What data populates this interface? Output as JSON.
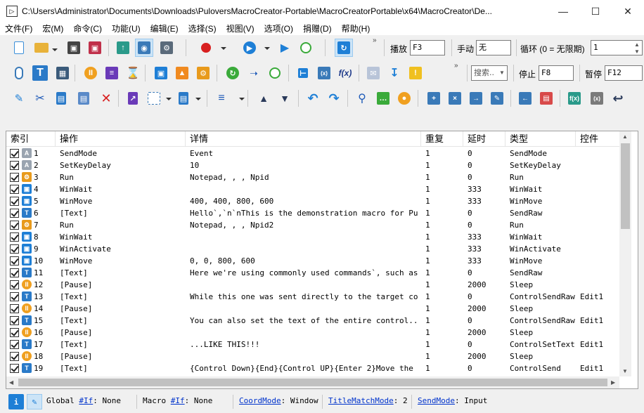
{
  "window": {
    "title": "C:\\Users\\Administrator\\Documents\\Downloads\\PuloversMacroCreator-Portable\\MacroCreatorPortable\\x64\\MacroCreator\\De..."
  },
  "menu": [
    "文件(F)",
    "宏(M)",
    "命令(C)",
    "功能(U)",
    "编辑(E)",
    "选择(S)",
    "视图(V)",
    "选项(O)",
    "捐赠(D)",
    "帮助(H)"
  ],
  "toolbar1": {
    "play_label": "播放",
    "play_hotkey": "F3",
    "manual_label": "手动",
    "manual_value": "无",
    "loop_label": "循环 (0 = 无限期)",
    "loop_value": "1"
  },
  "toolbar2": {
    "search_placeholder": "搜索..",
    "stop_label": "停止",
    "stop_hotkey": "F8",
    "pause_label": "暂停",
    "pause_hotkey": "F12"
  },
  "grid": {
    "columns": [
      "索引",
      "操作",
      "详情",
      "重复",
      "延时",
      "类型",
      "控件"
    ],
    "rows": [
      {
        "index": "1",
        "action": "SendMode",
        "details": "Event",
        "repeat": "1",
        "delay": "0",
        "type": "SendMode",
        "control": "",
        "icon": "sendmode-icon"
      },
      {
        "index": "2",
        "action": "SetKeyDelay",
        "details": "10",
        "repeat": "1",
        "delay": "0",
        "type": "SetKeyDelay",
        "control": "",
        "icon": "sendmode-icon"
      },
      {
        "index": "3",
        "action": "Run",
        "details": "Notepad, , , Npid",
        "repeat": "1",
        "delay": "0",
        "type": "Run",
        "control": "",
        "icon": "run-icon"
      },
      {
        "index": "4",
        "action": "WinWait",
        "details": "",
        "repeat": "1",
        "delay": "333",
        "type": "WinWait",
        "control": "",
        "icon": "window-icon"
      },
      {
        "index": "5",
        "action": "WinMove",
        "details": "400, 400, 800, 600",
        "repeat": "1",
        "delay": "333",
        "type": "WinMove",
        "control": "",
        "icon": "window-icon"
      },
      {
        "index": "6",
        "action": "[Text]",
        "details": "Hello`,`n`nThis is the demonstration macro for Pul...",
        "repeat": "1",
        "delay": "0",
        "type": "SendRaw",
        "control": "",
        "icon": "text-icon"
      },
      {
        "index": "7",
        "action": "Run",
        "details": "Notepad, , , Npid2",
        "repeat": "1",
        "delay": "0",
        "type": "Run",
        "control": "",
        "icon": "run-icon"
      },
      {
        "index": "8",
        "action": "WinWait",
        "details": "",
        "repeat": "1",
        "delay": "333",
        "type": "WinWait",
        "control": "",
        "icon": "window-icon"
      },
      {
        "index": "9",
        "action": "WinActivate",
        "details": "",
        "repeat": "1",
        "delay": "333",
        "type": "WinActivate",
        "control": "",
        "icon": "window-icon"
      },
      {
        "index": "10",
        "action": "WinMove",
        "details": "0, 0, 800, 600",
        "repeat": "1",
        "delay": "333",
        "type": "WinMove",
        "control": "",
        "icon": "window-icon"
      },
      {
        "index": "11",
        "action": "[Text]",
        "details": "Here we're using commonly used commands`, such as ...",
        "repeat": "1",
        "delay": "0",
        "type": "SendRaw",
        "control": "",
        "icon": "text-icon"
      },
      {
        "index": "12",
        "action": "[Pause]",
        "details": "",
        "repeat": "1",
        "delay": "2000",
        "type": "Sleep",
        "control": "",
        "icon": "pause-icon"
      },
      {
        "index": "13",
        "action": "[Text]",
        "details": "While this one was sent directly to the target con...",
        "repeat": "1",
        "delay": "0",
        "type": "ControlSendRaw",
        "control": "Edit1",
        "icon": "text-icon"
      },
      {
        "index": "14",
        "action": "[Pause]",
        "details": "",
        "repeat": "1",
        "delay": "2000",
        "type": "Sleep",
        "control": "",
        "icon": "pause-icon"
      },
      {
        "index": "15",
        "action": "[Text]",
        "details": "You can also set the text of the entire control...",
        "repeat": "1",
        "delay": "0",
        "type": "ControlSendRaw",
        "control": "Edit1",
        "icon": "text-icon"
      },
      {
        "index": "16",
        "action": "[Pause]",
        "details": "",
        "repeat": "1",
        "delay": "2000",
        "type": "Sleep",
        "control": "",
        "icon": "pause-icon"
      },
      {
        "index": "17",
        "action": "[Text]",
        "details": "...LIKE THIS!!!",
        "repeat": "1",
        "delay": "0",
        "type": "ControlSetText",
        "control": "Edit1",
        "icon": "text-icon"
      },
      {
        "index": "18",
        "action": "[Pause]",
        "details": "",
        "repeat": "1",
        "delay": "2000",
        "type": "Sleep",
        "control": "",
        "icon": "pause-icon"
      },
      {
        "index": "19",
        "action": "[Text]",
        "details": "{Control Down}{End}{Control UP}{Enter 2}Move the m...",
        "repeat": "1",
        "delay": "0",
        "type": "ControlSend",
        "control": "Edit1",
        "icon": "text-icon"
      }
    ]
  },
  "status": {
    "global_label": "Global",
    "global_if": "#If",
    "global_if_value": ": None",
    "macro_label": "Macro",
    "macro_if": "#If",
    "macro_if_value": ": None",
    "coord_link": "CoordMode",
    "coord_value": ": Window",
    "title_link": "TitleMatchMode",
    "title_value": ": 2",
    "send_link": "SendMode",
    "send_value": ": Input"
  },
  "colors": {
    "accent_blue": "#1e7fd6",
    "pause_orange": "#f0a020",
    "run_orange": "#e89a1c",
    "record_red": "#d82020",
    "link_blue": "#0033cc"
  }
}
